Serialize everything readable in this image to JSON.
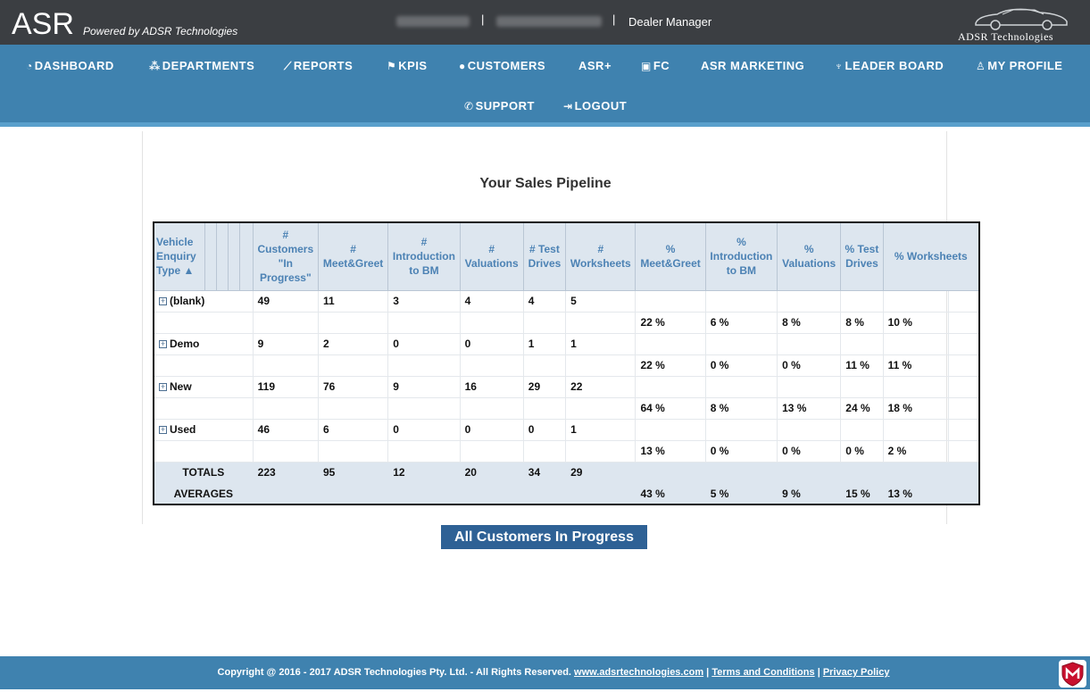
{
  "header": {
    "logo": "ASR",
    "powered": "Powered by ADSR Technologies",
    "separator": "|",
    "role": "Dealer Manager",
    "brand": "ADSR Technologies"
  },
  "nav": {
    "dashboard": "DASHBOARD",
    "departments": "DEPARTMENTS",
    "reports": "REPORTS",
    "kpis": "KPIS",
    "customers": "CUSTOMERS",
    "asr_plus": "ASR+",
    "fc": "FC",
    "asr_marketing": "ASR MARKETING",
    "leader_board": "LEADER BOARD",
    "my_profile": "MY PROFILE",
    "support": "SUPPORT",
    "logout": "LOGOUT"
  },
  "page": {
    "title": "Your Sales Pipeline",
    "button": "All Customers In Progress"
  },
  "table": {
    "col0_a": "Vehicle",
    "col0_b": "Enquiry",
    "col0_c": "Type",
    "headers": [
      "# Customers \"In Progress\"",
      "# Meet&Greet",
      "# Introduction to BM",
      "# Valuations",
      "# Test Drives",
      "# Worksheets",
      "% Meet&Greet",
      "% Introduction to BM",
      "% Valuations",
      "% Test Drives",
      "% Worksheets"
    ],
    "rows": [
      {
        "label": "(blank)",
        "counts": [
          "49",
          "11",
          "3",
          "4",
          "4",
          "5"
        ],
        "pcts": [
          "22 %",
          "6 %",
          "8 %",
          "8 %",
          "10 %"
        ]
      },
      {
        "label": "Demo",
        "counts": [
          "9",
          "2",
          "0",
          "0",
          "1",
          "1"
        ],
        "pcts": [
          "22 %",
          "0 %",
          "0 %",
          "11 %",
          "11 %"
        ]
      },
      {
        "label": "New",
        "counts": [
          "119",
          "76",
          "9",
          "16",
          "29",
          "22"
        ],
        "pcts": [
          "64 %",
          "8 %",
          "13 %",
          "24 %",
          "18 %"
        ]
      },
      {
        "label": "Used",
        "counts": [
          "46",
          "6",
          "0",
          "0",
          "0",
          "1"
        ],
        "pcts": [
          "13 %",
          "0 %",
          "0 %",
          "0 %",
          "2 %"
        ]
      }
    ],
    "totals_label": "TOTALS",
    "totals": [
      "223",
      "95",
      "12",
      "20",
      "34",
      "29"
    ],
    "averages_label": "AVERAGES",
    "averages": [
      "43 %",
      "5 %",
      "9 %",
      "15 %",
      "13 %"
    ]
  },
  "footer": {
    "copyright": "Copyright @ 2016 - 2017 ADSR Technologies Pty. Ltd. - All Rights Reserved.",
    "website": "www.adsrtechnologies.com",
    "sep": "|",
    "terms": "Terms and Conditions",
    "privacy": "Privacy Policy"
  },
  "icons": {
    "dashboard": "dashboard-icon",
    "departments": "sitemap-icon",
    "reports": "line-chart-icon",
    "kpis": "flag-icon",
    "customers": "users-icon",
    "fc": "money-icon",
    "leader_board": "trophy-icon",
    "my_profile": "user-icon",
    "support": "phone-icon",
    "logout": "logout-icon",
    "shield": "mcafee-shield-icon"
  }
}
